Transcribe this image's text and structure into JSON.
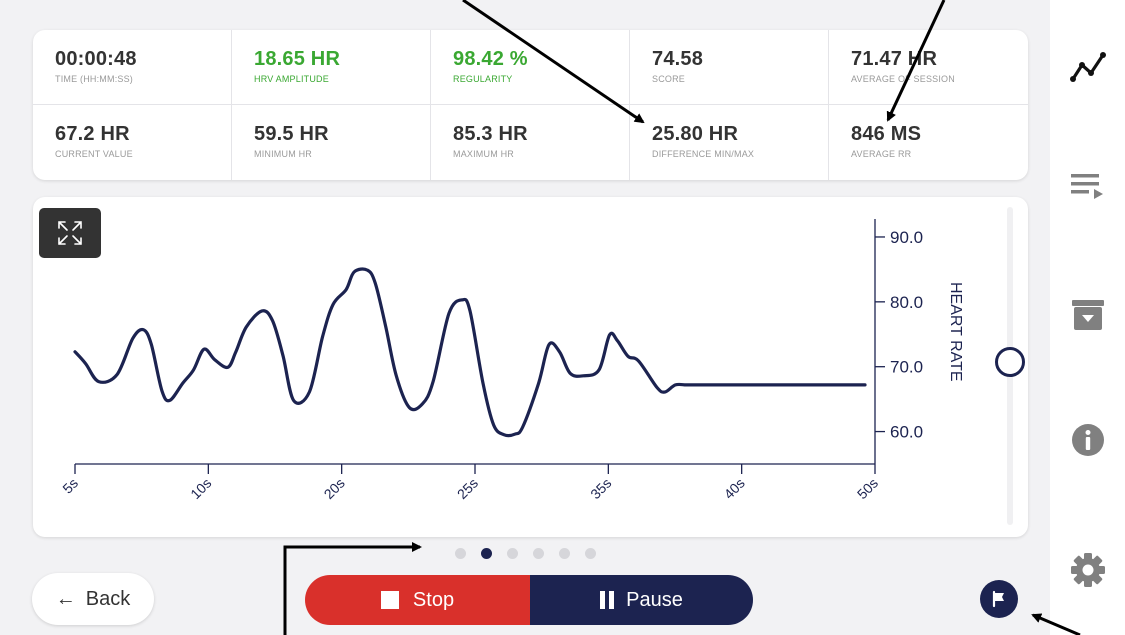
{
  "stats": [
    {
      "value": "00:00:48",
      "label": "TIME (HH:MM:SS)"
    },
    {
      "value": "18.65 HR",
      "label": "HRV AMPLITUDE"
    },
    {
      "value": "98.42 %",
      "label": "REGULARITY"
    },
    {
      "value": "74.58",
      "label": "SCORE"
    },
    {
      "value": "71.47 HR",
      "label": "AVERAGE OF SESSION"
    },
    {
      "value": "67.2 HR",
      "label": "CURRENT VALUE"
    },
    {
      "value": "59.5 HR",
      "label": "MINIMUM HR"
    },
    {
      "value": "85.3 HR",
      "label": "MAXIMUM HR"
    },
    {
      "value": "25.80 HR",
      "label": "DIFFERENCE MIN/MAX"
    },
    {
      "value": "846 MS",
      "label": "AVERAGE RR"
    }
  ],
  "colors": {
    "accent_green": "#3aa832",
    "navy": "#1c2350",
    "stop_red": "#d9302b"
  },
  "chart_data": {
    "type": "line",
    "ylabel": "HEART RATE",
    "y_ticks": [
      "90.0",
      "80.0",
      "70.0",
      "60.0"
    ],
    "ylim": [
      55,
      92
    ],
    "x_ticks": [
      "5s",
      "10s",
      "20s",
      "25s",
      "35s",
      "40s",
      "50s"
    ],
    "series": [
      {
        "x": [
          0,
          0.4,
          0.9,
          1.6,
          2.2,
          2.6,
          2.9,
          3.3,
          3.6,
          4.1,
          4.5,
          4.9,
          5.3,
          5.8,
          6.1,
          6.5,
          7.1,
          7.5,
          7.9,
          8.3,
          8.9,
          9.4,
          9.8,
          10.3,
          10.6,
          11.1,
          11.4,
          11.8,
          12.2,
          12.7,
          13.2,
          13.6,
          14.2,
          14.7,
          15.0,
          15.5,
          15.9,
          16.3,
          16.7,
          17.0,
          17.6,
          18.0,
          18.4,
          18.8,
          19.3,
          19.9,
          20.3,
          20.6,
          21.0,
          21.4,
          22.1,
          22.4,
          22.8,
          23.2,
          23.5,
          24.0,
          24.4,
          24.8,
          25.3,
          25.9,
          26.6,
          27.0,
          27.4,
          27.9,
          28.5,
          28.9,
          29.3,
          29.6,
          30.0
        ],
        "y": [
          72.3,
          70.5,
          67.7,
          68.8,
          74.4,
          75.7,
          73.4,
          66.3,
          64.8,
          67.5,
          69.5,
          72.7,
          71.1,
          69.9,
          72.2,
          76.1,
          78.6,
          77.1,
          71.7,
          64.8,
          66.1,
          74.6,
          79.6,
          81.9,
          84.6,
          84.9,
          82.9,
          76.2,
          68.6,
          63.7,
          64.3,
          67.7,
          78.2,
          80.3,
          78.6,
          67.3,
          61.0,
          59.5,
          59.6,
          60.7,
          67.4,
          73.4,
          72.3,
          69.0,
          68.6,
          69.5,
          74.9,
          74.0,
          71.6,
          70.9,
          66.8,
          66.1,
          67.2,
          67.2,
          67.2,
          67.2,
          67.2,
          67.2,
          67.2,
          67.2,
          67.2,
          67.2,
          67.2,
          67.2,
          67.2,
          67.2,
          67.2,
          67.2,
          67.2
        ]
      }
    ]
  },
  "pager": {
    "count": 6,
    "active": 1
  },
  "controls": {
    "back_label": "Back",
    "stop_label": "Stop",
    "pause_label": "Pause"
  },
  "sidebar": {
    "icons": [
      "chart-line-icon",
      "playlist-icon",
      "archive-download-icon",
      "info-icon",
      "gear-icon"
    ]
  }
}
